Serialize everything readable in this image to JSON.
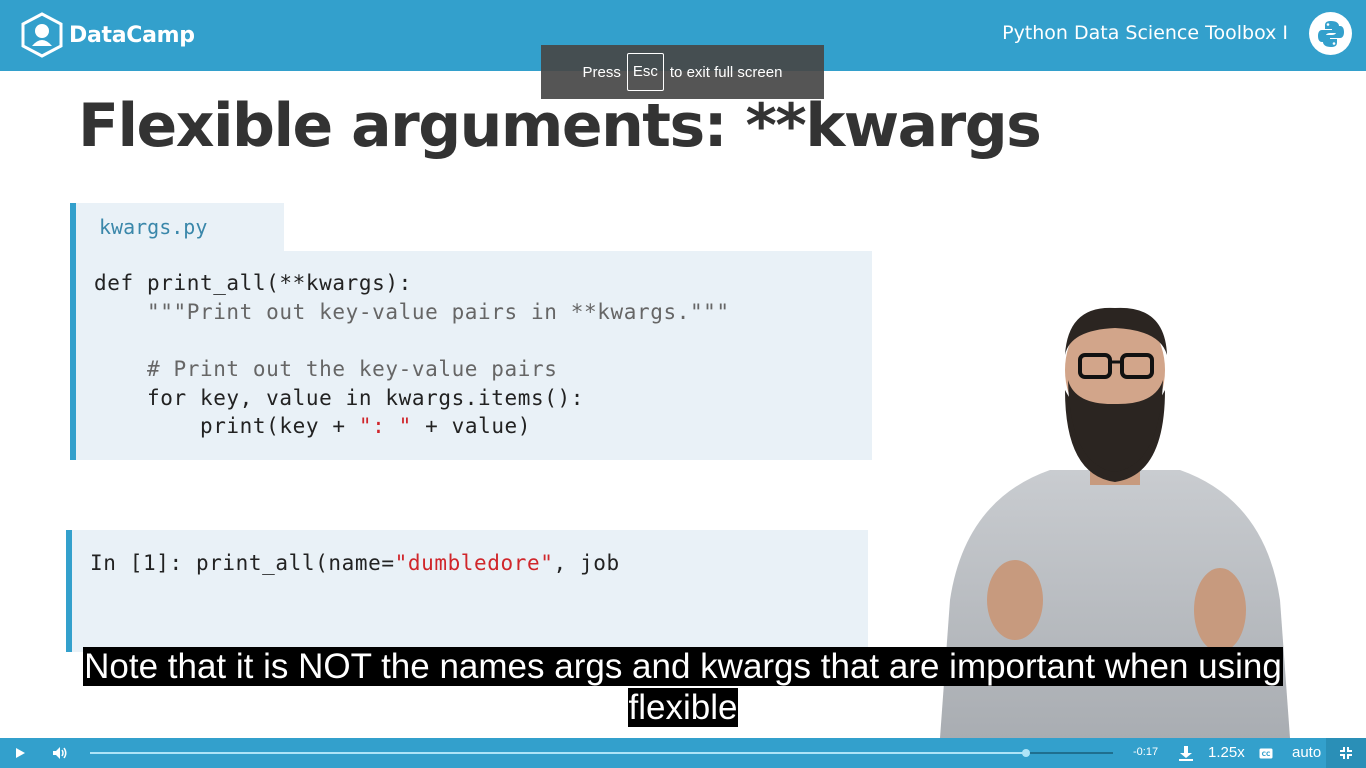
{
  "header": {
    "brand_name": "DataCamp",
    "course_title": "Python Data Science Toolbox I",
    "brand_color": "#33a0cc"
  },
  "fullscreen_notice": {
    "prefix": "Press",
    "key": "Esc",
    "suffix": "to exit full screen"
  },
  "slide": {
    "title": "Flexible arguments: **kwargs",
    "file_tab": "kwargs.py",
    "code_lines": [
      "def print_all(**kwargs):",
      "    \"\"\"Print out key-value pairs in **kwargs.\"\"\"",
      "    # Print out the key-value pairs",
      "    for key, value in kwargs.items():",
      "        print(key + ",
      "\": \"",
      " + value)"
    ],
    "console": {
      "prompt": "In [1]: print_all(name=",
      "string": "\"dumbledore\"",
      "rest": ", job"
    }
  },
  "captions": {
    "line1": "Note that it is NOT the names args and kwargs that are important when using",
    "line2": "flexible"
  },
  "player": {
    "progress": 0.915,
    "time_remaining": "-0:17",
    "speed": "1.25x",
    "quality": "auto",
    "icons": [
      "play-icon",
      "volume-icon",
      "download-icon",
      "captions-icon",
      "exit-fullscreen-icon"
    ]
  }
}
